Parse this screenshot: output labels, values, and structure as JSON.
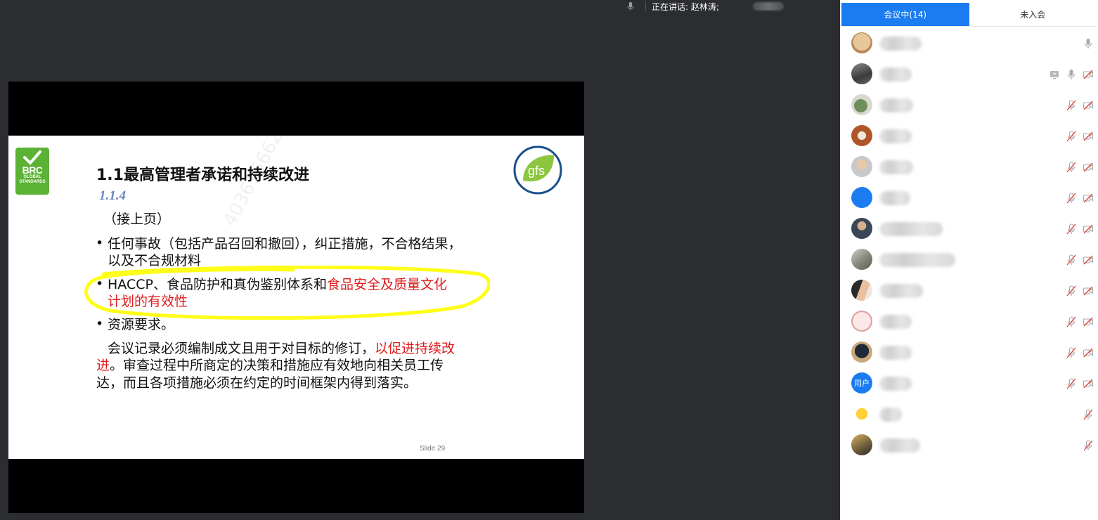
{
  "topbar": {
    "speaking_label": "正在讲话: 赵林涛;"
  },
  "slide": {
    "title": "1.1最高管理者承诺和持续改进",
    "subtitle": "1.1.4",
    "line1": "（接上页）",
    "bullet1_line1": "任何事故（包括产品召回和撤回），纠正措施，不合格结果，",
    "bullet1_line2": "以及不合规材料",
    "bullet2_line1_black": "HACCP、食品防护和真伪鉴别体系和",
    "bullet2_line1_red": "食品安全及质量文化",
    "bullet2_line2_red": "计划的有效性",
    "bullet3": "资源要求。",
    "para_line1_black": "会议记录必须编制成文且用于对目标的修订，",
    "para_line1_red": "以促进持续改",
    "para_line2_red": "进",
    "para_line2_black": "。审查过程中所商定的决策和措施应有效地向相关员工传",
    "para_line3": "达，而且各项措施必须在约定的时间框架内得到落实。",
    "brc_text": "BRC",
    "brc_sub1": "GLOBAL",
    "brc_sub2": "STANDARDS",
    "gfs_text": "gfs",
    "watermark": "4036156626 605",
    "slide_number": "Slide 29",
    "bullet_char": "•"
  },
  "sidebar": {
    "tabs": [
      {
        "label": "会议中(14)",
        "active": true
      },
      {
        "label": "未入会",
        "active": false
      }
    ],
    "participants": [
      {
        "avatar": "plush-toy",
        "name_width": 60,
        "icons": [
          "mic"
        ]
      },
      {
        "avatar": "photo-gray",
        "name_width": 46,
        "icons": [
          "screen",
          "mic",
          "cam-off"
        ]
      },
      {
        "avatar": "plant",
        "name_width": 48,
        "icons": [
          "mic-off",
          "cam-off"
        ]
      },
      {
        "avatar": "photo-brown",
        "name_width": 46,
        "icons": [
          "mic-off",
          "cam-off"
        ]
      },
      {
        "avatar": "person-light",
        "name_width": 48,
        "icons": [
          "mic-off",
          "cam-off"
        ]
      },
      {
        "avatar": "blue-circle",
        "name_width": 44,
        "icons": [
          "mic-off",
          "cam-off"
        ]
      },
      {
        "avatar": "person-dark",
        "name_width": 90,
        "icons": [
          "mic-off",
          "cam-off"
        ]
      },
      {
        "avatar": "photo-outdoor",
        "name_width": 108,
        "icons": [
          "mic-off",
          "cam-off"
        ]
      },
      {
        "avatar": "person-side",
        "name_width": 62,
        "icons": [
          "mic-off",
          "cam-off"
        ]
      },
      {
        "avatar": "cartoon",
        "name_width": 46,
        "icons": [
          "mic-off",
          "cam-off"
        ]
      },
      {
        "avatar": "helmet",
        "name_width": 46,
        "icons": [
          "mic-off",
          "cam-off"
        ]
      },
      {
        "avatar": "user-text",
        "avatar_text": "用户",
        "name_width": 46,
        "icons": [
          "mic-off",
          "cam-off"
        ]
      },
      {
        "avatar": "sun",
        "name_width": 32,
        "icons": [
          "mic-off"
        ]
      },
      {
        "avatar": "photo-gold",
        "name_width": 58,
        "icons": [
          "mic-off"
        ]
      }
    ]
  },
  "colors": {
    "accent": "#1a7cf0",
    "highlight": "#ffff1a",
    "red_text": "#e01b1b",
    "brc_green": "#5bb234",
    "gfs_blue": "#1b4f8a",
    "gfs_green": "#8cc63f"
  }
}
